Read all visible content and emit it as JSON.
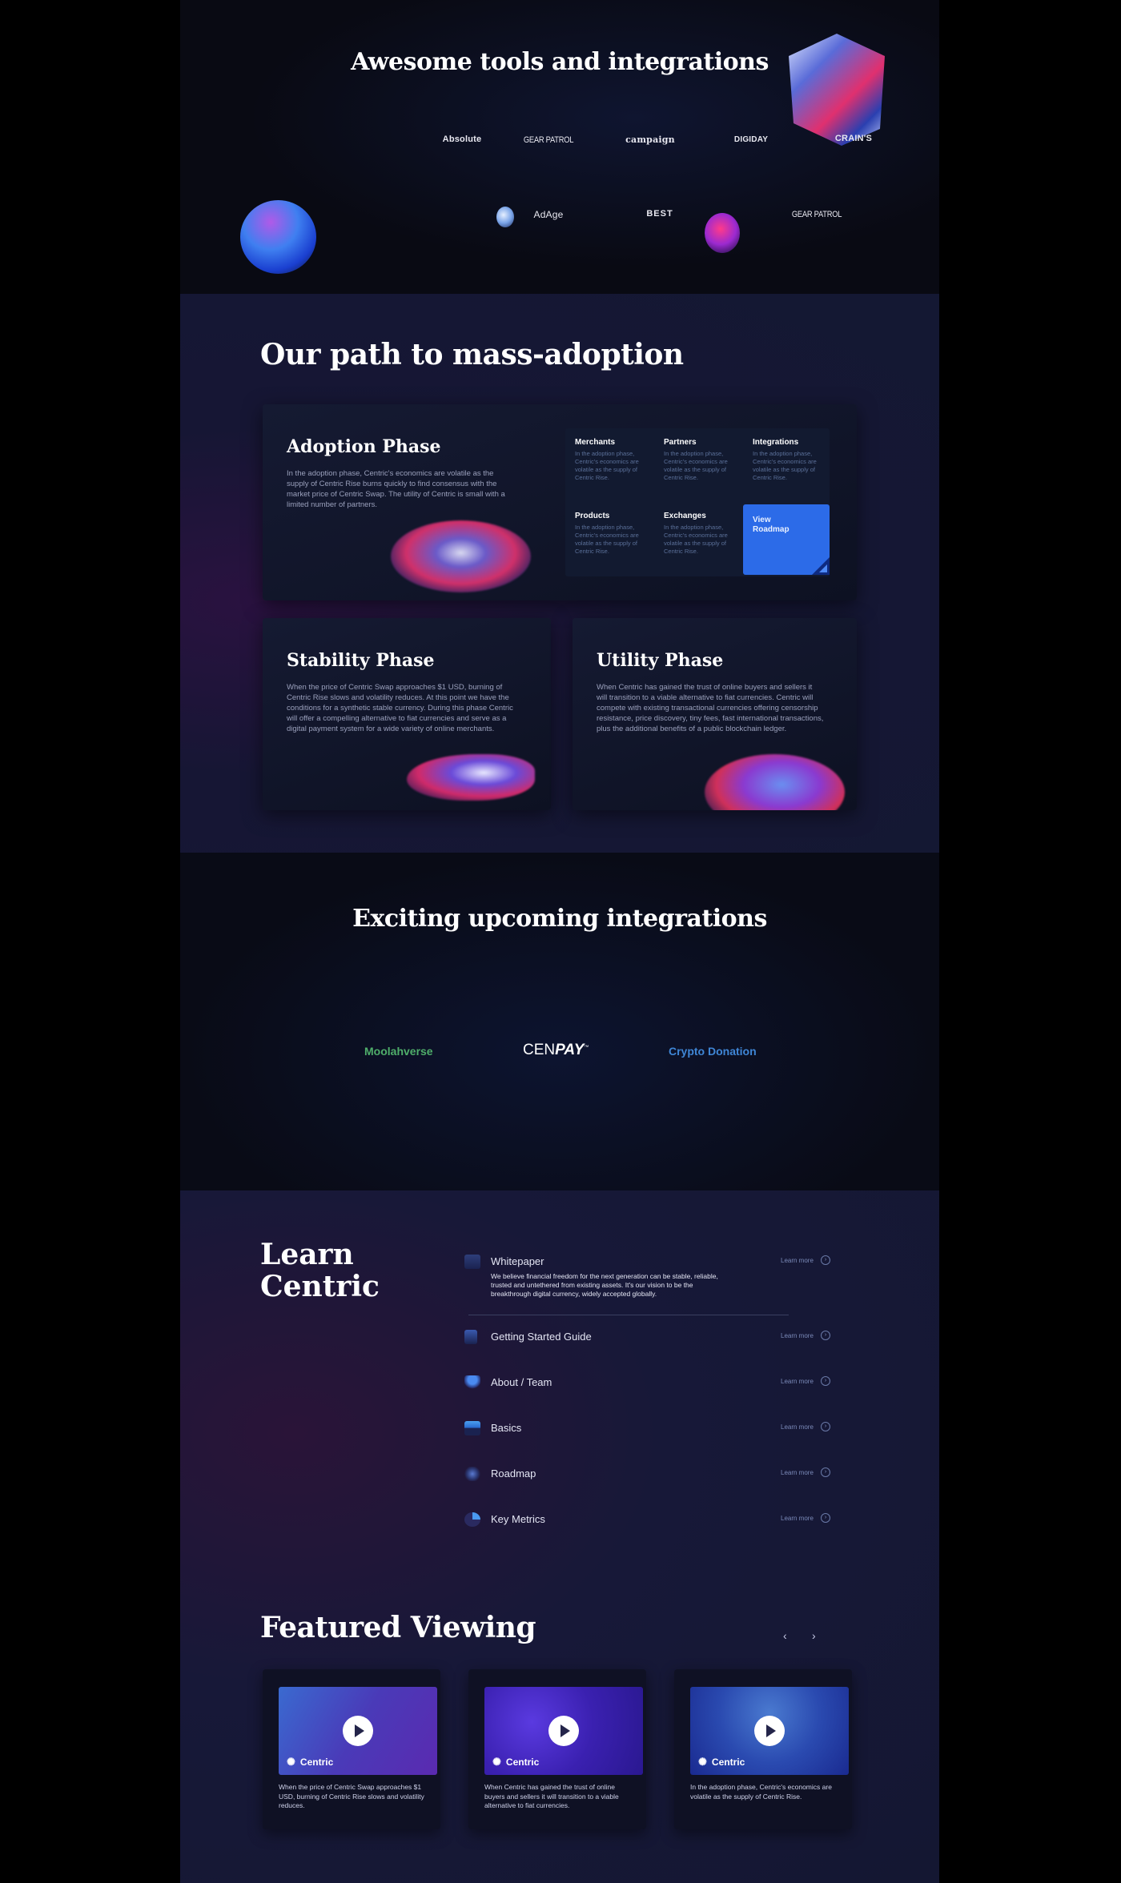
{
  "tools": {
    "title": "Awesome tools and integrations",
    "logos_row1": [
      "Absolute",
      "GEAR PATROL",
      "campaign",
      "DIGIDAY",
      "CRAIN'S"
    ],
    "logos_row2": [
      "AdAge",
      "BEST",
      "GEAR PATROL"
    ]
  },
  "path": {
    "title": "Our path to mass-adoption",
    "adoption": {
      "title": "Adoption Phase",
      "text": "In the adoption phase, Centric's economics are volatile as the supply of Centric Rise burns quickly to find consensus with the market price of Centric Swap. The utility of Centric is small with a limited number of partners."
    },
    "grid": [
      {
        "title": "Merchants",
        "text": "In the adoption phase, Centric's economics are volatile as the supply of Centric Rise."
      },
      {
        "title": "Partners",
        "text": "In the adoption phase, Centric's economics are volatile as the supply of Centric Rise."
      },
      {
        "title": "Integrations",
        "text": "In the adoption phase, Centric's economics are volatile as the supply of Centric Rise."
      },
      {
        "title": "Products",
        "text": "In the adoption phase, Centric's economics are volatile as the supply of Centric Rise."
      },
      {
        "title": "Exchanges",
        "text": "In the adoption phase, Centric's economics are volatile as the supply of Centric Rise."
      }
    ],
    "roadmap_label": "View Roadmap",
    "stability": {
      "title": "Stability Phase",
      "text": "When the price of Centric Swap approaches $1 USD, burning of Centric Rise slows and volatility reduces. At this point we have the conditions for a synthetic stable currency. During this phase Centric will offer a compelling alternative to fiat currencies and serve as a digital payment system for a wide variety of online merchants."
    },
    "utility": {
      "title": "Utility Phase",
      "text": "When Centric has gained the trust of online buyers and sellers it will transition to a viable alternative to fiat currencies. Centric will compete with existing transactional currencies offering censorship resistance, price discovery, tiny fees, fast international transactions, plus the additional benefits of a public blockchain ledger."
    }
  },
  "upcoming": {
    "title": "Exciting upcoming integrations",
    "logos": [
      {
        "label": "Moolahverse",
        "color": "#4fae6a"
      },
      {
        "label_a": "CEN",
        "label_b": "PAY",
        "tm": "™",
        "color": "#ffffff"
      },
      {
        "label": "Crypto Donation",
        "color": "#3f86d6"
      }
    ]
  },
  "learn": {
    "title_line1": "Learn",
    "title_line2": "Centric",
    "more_label": "Learn more",
    "arrow_glyph": "›",
    "items": [
      {
        "label": "Whitepaper",
        "desc": "We believe financial freedom for the next generation can be stable, reliable, trusted and untethered from existing assets. It's our vision to be the breakthrough digital currency, widely accepted globally."
      },
      {
        "label": "Getting Started Guide"
      },
      {
        "label": "About / Team"
      },
      {
        "label": "Basics"
      },
      {
        "label": "Roadmap"
      },
      {
        "label": "Key Metrics"
      }
    ]
  },
  "featured": {
    "title": "Featured Viewing",
    "prev": "‹",
    "next": "›",
    "brand": "Centric",
    "brand_icon": "✺",
    "videos": [
      {
        "desc": "When the price of Centric Swap approaches $1 USD, burning of Centric Rise slows and volatility reduces."
      },
      {
        "desc": "When Centric has gained the trust of online buyers and sellers it will transition to a viable alternative to fiat currencies."
      },
      {
        "desc": "In the adoption phase, Centric's economics are volatile as the supply of Centric Rise."
      }
    ]
  },
  "colors": {
    "accent_blue": "#2c6be8",
    "moolahverse_green": "#4fae6a",
    "crypto_donation_blue": "#3f86d6"
  }
}
